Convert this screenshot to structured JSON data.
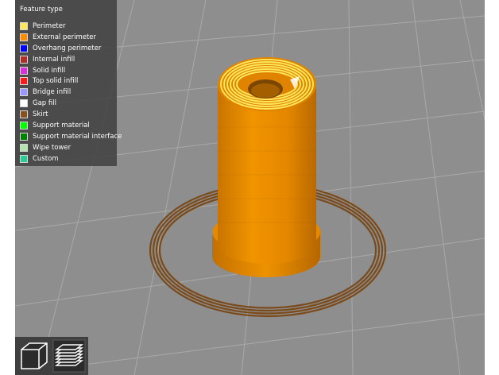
{
  "legend": {
    "title": "Feature type",
    "items": [
      {
        "label": "Perimeter",
        "color": "#FFE65A"
      },
      {
        "label": "External perimeter",
        "color": "#FF8C00"
      },
      {
        "label": "Overhang perimeter",
        "color": "#0000FF"
      },
      {
        "label": "Internal infill",
        "color": "#B03029"
      },
      {
        "label": "Solid infill",
        "color": "#D732D7"
      },
      {
        "label": "Top solid infill",
        "color": "#FF1A1A"
      },
      {
        "label": "Bridge infill",
        "color": "#9999FF"
      },
      {
        "label": "Gap fill",
        "color": "#FFFFFF"
      },
      {
        "label": "Skirt",
        "color": "#845321"
      },
      {
        "label": "Support material",
        "color": "#00FF00"
      },
      {
        "label": "Support material interface",
        "color": "#008000"
      },
      {
        "label": "Wipe tower",
        "color": "#B3E3AB"
      },
      {
        "label": "Custom",
        "color": "#28CC94"
      }
    ]
  },
  "toolbar": {
    "buttons": [
      {
        "name": "3d-view-icon"
      },
      {
        "name": "layers-view-icon"
      }
    ]
  },
  "colors": {
    "background": "#8E8E8E",
    "grid": "#A8A8A8",
    "model_orange": "#E88A00",
    "skirt_brown": "#845321"
  }
}
